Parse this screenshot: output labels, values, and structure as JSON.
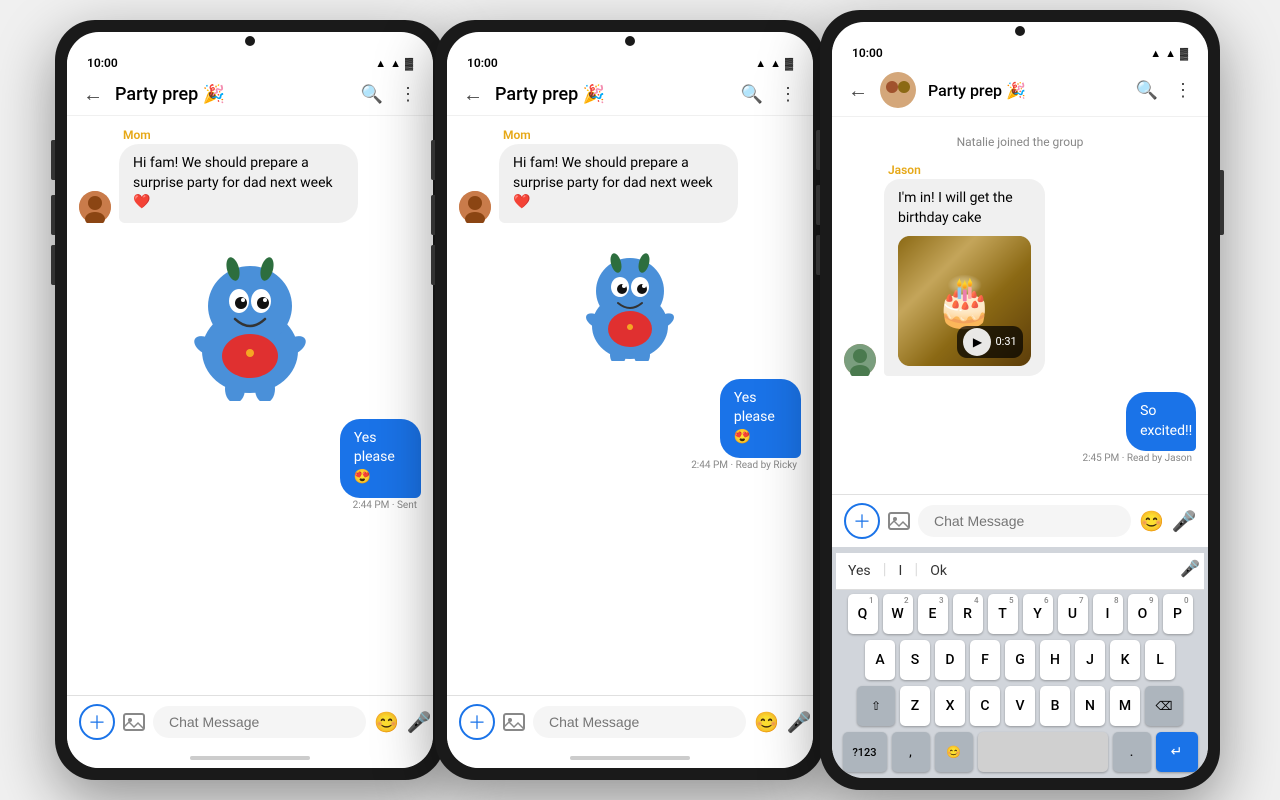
{
  "phones": [
    {
      "id": "phone-1",
      "statusBar": {
        "time": "10:00",
        "icons": "▲ ▲ ▲"
      },
      "header": {
        "title": "Party prep 🎉",
        "backLabel": "←",
        "searchLabel": "🔍",
        "moreLabel": "⋮"
      },
      "messages": [
        {
          "id": "msg-mom-1",
          "sender": "Mom",
          "senderColor": "#e6a817",
          "text": "Hi fam! We should prepare a surprise party for dad next week ❤️",
          "type": "received",
          "hasAvatar": true
        },
        {
          "id": "msg-sticker-1",
          "type": "sticker",
          "size": "large"
        },
        {
          "id": "msg-yes-1",
          "text": "Yes please 😍",
          "type": "sent",
          "time": "2:44 PM · Sent"
        }
      ],
      "input": {
        "placeholder": "Chat Message"
      }
    },
    {
      "id": "phone-2",
      "statusBar": {
        "time": "10:00",
        "icons": "▲ ▲ ▲"
      },
      "header": {
        "title": "Party prep 🎉",
        "backLabel": "←",
        "searchLabel": "🔍",
        "moreLabel": "⋮"
      },
      "messages": [
        {
          "id": "msg-mom-2",
          "sender": "Mom",
          "senderColor": "#e6a817",
          "text": "Hi fam! We should prepare a surprise party for dad next week ❤️",
          "type": "received",
          "hasAvatar": true
        },
        {
          "id": "msg-sticker-2",
          "type": "sticker",
          "size": "small"
        },
        {
          "id": "msg-yes-2",
          "text": "Yes please 😍",
          "type": "sent",
          "time": "2:44 PM · Read by Ricky"
        }
      ],
      "input": {
        "placeholder": "Chat Message"
      }
    },
    {
      "id": "phone-3",
      "statusBar": {
        "time": "10:00",
        "icons": "▲ ▲ ▲"
      },
      "header": {
        "title": "Party prep 🎉",
        "backLabel": "←",
        "searchLabel": "🔍",
        "moreLabel": "⋮"
      },
      "systemMsg": "Natalie joined the group",
      "messages": [
        {
          "id": "msg-jason-1",
          "sender": "Jason",
          "senderColor": "#e6a817",
          "text": "I'm in! I will get the birthday cake",
          "type": "received",
          "hasAvatar": true,
          "hasVideo": true,
          "videoDuration": "0:31"
        },
        {
          "id": "msg-excited-1",
          "text": "So excited!!",
          "type": "sent",
          "time": "2:45 PM · Read by Jason"
        }
      ],
      "input": {
        "placeholder": "Chat Message"
      },
      "keyboard": {
        "suggestions": [
          "Yes",
          "I",
          "Ok"
        ],
        "rows": [
          [
            "Q",
            "W",
            "E",
            "R",
            "T",
            "Y",
            "U",
            "I",
            "O",
            "P"
          ],
          [
            "A",
            "S",
            "D",
            "F",
            "G",
            "H",
            "J",
            "K",
            "L"
          ],
          [
            "⇧",
            "Z",
            "X",
            "C",
            "V",
            "B",
            "N",
            "M",
            "⌫"
          ],
          [
            "?123",
            ",",
            "😊",
            "[space]",
            ".",
            "↵"
          ]
        ],
        "nums": [
          "1",
          "2",
          "3",
          "4",
          "5",
          "6",
          "7",
          "8",
          "9",
          "0"
        ]
      }
    }
  ]
}
